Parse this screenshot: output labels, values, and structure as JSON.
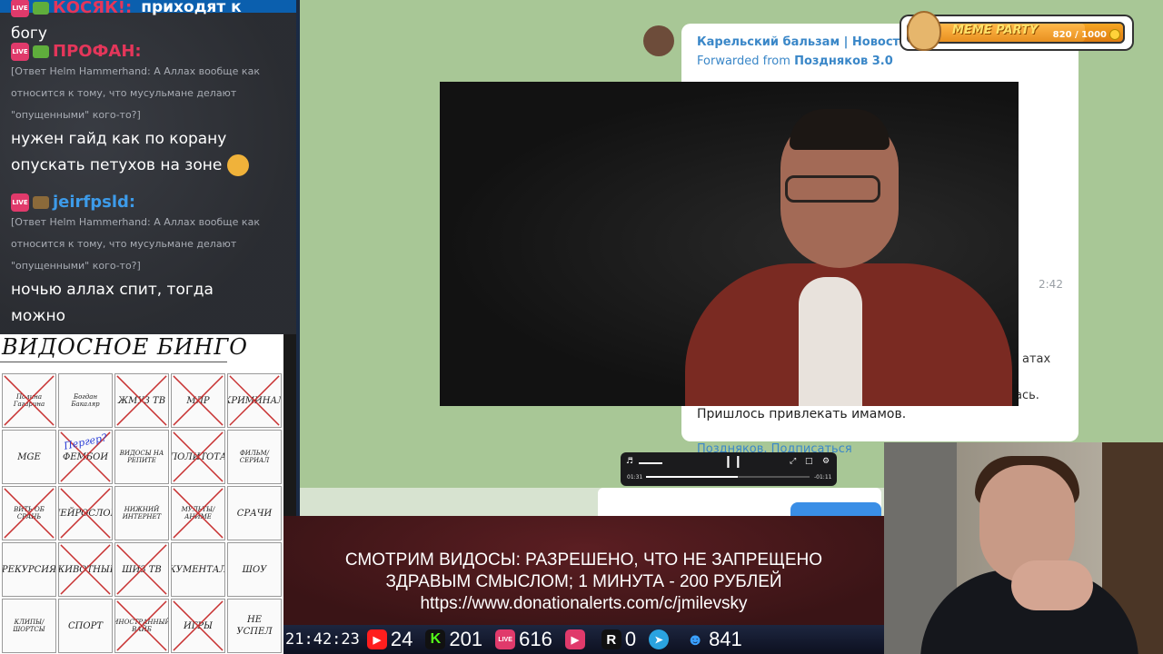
{
  "chat": {
    "messages": [
      {
        "user": "КОСЯК!:",
        "quote": "",
        "text": "приходят к",
        "text2": "богу"
      },
      {
        "user": "ПРОФАН:",
        "quote1": "[Ответ Helm Hammerhand: А Аллах вообще как",
        "quote2": "относится к тому, что мусульмане делают",
        "quote3": "\"опущенными\" кого-то?]",
        "text1": "нужен гайд как по корану",
        "text2": "опускать петухов на зоне"
      },
      {
        "user": "jeirfpsld:",
        "quote1": "[Ответ Helm Hammerhand: А Аллах вообще как",
        "quote2": "относится к тому, что мусульмане делают",
        "quote3": "\"опущенными\" кого-то?]",
        "text1": "ночью аллах спит, тогда",
        "text2": "можно"
      }
    ],
    "live_label": "LIVE"
  },
  "bingo": {
    "title": "ВИДОСНОЕ БИНГО",
    "cells": [
      {
        "label": "Полина Гагарина",
        "crossed": true
      },
      {
        "label": "Богдан Бакаляр",
        "crossed": false
      },
      {
        "label": "ЖМУЗ ТВ",
        "crossed": true
      },
      {
        "label": "МЛР",
        "crossed": true
      },
      {
        "label": "КРИМИНАЛ",
        "crossed": true
      },
      {
        "label": "MGE",
        "crossed": false
      },
      {
        "label": "ФЕМБОИ",
        "crossed": true
      },
      {
        "label": "ВИДОСЫ НА РЕПИТЕ",
        "crossed": false
      },
      {
        "label": "ПОЛИТОТА",
        "crossed": true
      },
      {
        "label": "ФИЛЬМ/ СЕРИАЛ",
        "crossed": false
      },
      {
        "label": "ВИТЬ ОБ СРАНЬ",
        "crossed": true
      },
      {
        "label": "НЕЙРОСЛОП",
        "crossed": true
      },
      {
        "label": "НИЖНИЙ ИНТЕРНЕТ",
        "crossed": false
      },
      {
        "label": "МУЛЬТЫ/ АНИМЕ",
        "crossed": true
      },
      {
        "label": "СРАЧИ",
        "crossed": false
      },
      {
        "label": "РЕКУРСИЯ",
        "crossed": false
      },
      {
        "label": "ЖИВОТНЫЕ",
        "crossed": true
      },
      {
        "label": "ШИЗ ТВ",
        "crossed": true
      },
      {
        "label": "ДОКУМЕНТАЛКИ",
        "crossed": false
      },
      {
        "label": "ШОУ",
        "crossed": false
      },
      {
        "label": "КЛИПЫ/ ШОРТСЫ",
        "crossed": false
      },
      {
        "label": "СПОРТ",
        "crossed": false
      },
      {
        "label": "ИНОСТРАННЫЙ ВАЙБ",
        "crossed": true
      },
      {
        "label": "ИГРЫ",
        "crossed": true
      },
      {
        "label": "НЕ УСПЕЛ",
        "crossed": false
      }
    ],
    "handwritten": "Пергер?"
  },
  "telegram": {
    "channel": "Карельский бальзам | Новости",
    "forwarded_prefix": "Forwarded from",
    "forwarded_from": "Поздняков 3.0",
    "duration": "2:42",
    "snippet1": "атах",
    "snippet2": "ась.",
    "text": "Пришлось привлекать имамов.",
    "footer": "Поздняков. Подписаться"
  },
  "player": {
    "current_time": "01:31",
    "remaining_time": "-01:11",
    "progress": 0.56,
    "volume": 0.45
  },
  "banner": {
    "line1": "СМОТРИМ ВИДОСЫ: РАЗРЕШЕНО, ЧТО НЕ ЗАПРЕЩЕНО",
    "line2": "ЗДРАВЫМ СМЫСЛОМ; 1 МИНУТА - 200 РУБЛЕЙ",
    "line3": "https://www.donationalerts.com/c/jmilevsky"
  },
  "stats": {
    "time": "21:42:23",
    "youtube": "24",
    "kick": "201",
    "vk_live": "616",
    "rutube": "0",
    "r_platform": "0",
    "telegram": "",
    "viewers": "841",
    "colors": {
      "youtube": "#ff1e1e",
      "kick": "#53fc18",
      "vk_live": "#e03a6b",
      "rutube": "#e03a6b",
      "telegram": "#2aa3e0",
      "viewers": "#3aa0ff"
    }
  },
  "meme_party": {
    "title": "MEME PARTY",
    "count": "820 / 1000",
    "progress": 0.82
  }
}
